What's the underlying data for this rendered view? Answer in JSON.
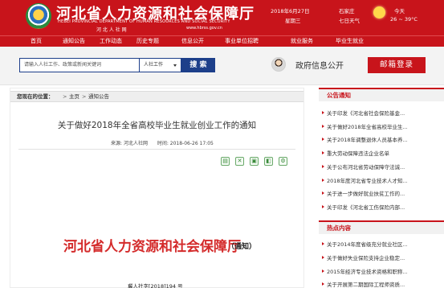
{
  "header": {
    "title_cn": "河北省人力资源和社会保障厅",
    "title_en": "HEBEI PROVINCIAL DEPARTMENT OF HUMAN RESOURCES AND SOCIAL SECURITY",
    "subtitle": "河 北 人 社 网",
    "url": "www.hbrss.gov.cn",
    "date": "2018年6月27日",
    "weekday": "星期三",
    "place": "石家庄",
    "forecast_label": "七日天气",
    "weather_today": "今天",
    "temperature": "26 ~ 39°C"
  },
  "nav": {
    "items": [
      {
        "label": "首页"
      },
      {
        "label": "通知公告"
      },
      {
        "label": "工作动态"
      },
      {
        "label": "历史专题"
      },
      {
        "label": "信息公开"
      },
      {
        "label": "事业单位招聘"
      },
      {
        "label": "就业服务"
      },
      {
        "label": "毕业生就业"
      }
    ]
  },
  "search": {
    "placeholder": "请输入人社工作、政策或新闻关键词",
    "scope": "人社工作",
    "button": "搜 索",
    "gov_info": "政府信息公开",
    "mail_button": "邮箱登录"
  },
  "breadcrumb": {
    "label": "您现在的位置：",
    "items": [
      "主页",
      "通知公告"
    ],
    "separator": ">"
  },
  "article": {
    "title": "关于做好2018年全省高校毕业生就业创业工作的通知",
    "source_label": "来源:",
    "source": "河北人社网",
    "time_label": "时间:",
    "time": "2018-06-26 17:05",
    "doc_header": "河北省人力资源和社会保障厅",
    "doc_header_tag": "（通知）",
    "doc_number": "冀人社字[2018]194 号"
  },
  "sidebar": {
    "notices_title": "公告通知",
    "notices": [
      "关于印发《河北省社会保险基金...",
      "关于做好2018年全省高校毕业生...",
      "关于2018年调整退休人员基本养...",
      "重大劳动保障违法企业名单",
      "关于公布河北省劳动保障守法诚...",
      "2018年度河北省专业技术人才知...",
      "关于进一步做好就业扶贫工作的...",
      "关于印发《河北省工伤保险内部..."
    ],
    "hot_title": "热点内容",
    "hot": [
      "关于2014年度省级充分就业社区...",
      "关于做好失业保险支持企业稳定...",
      "2015年经济专业技术资格和职称...",
      "关于开展第二期国际工程师资质..."
    ]
  },
  "colors": {
    "brand_red": "#c8141b",
    "search_blue": "#1d3f8a"
  },
  "icons": [
    "emblem-logo-icon",
    "sun-icon",
    "avatar-icon",
    "print-icon",
    "share-icon",
    "save-icon",
    "font-size-icon",
    "settings-icon"
  ]
}
